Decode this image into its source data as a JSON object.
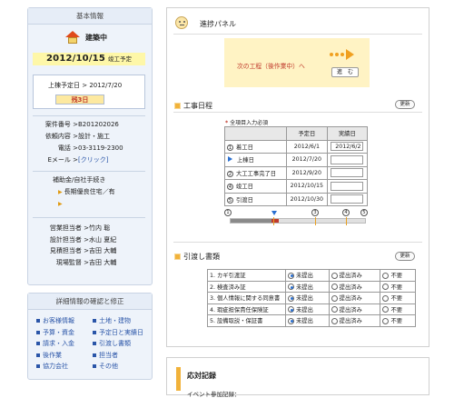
{
  "sidebar": {
    "basic_title": "基本情報",
    "status": "建築中",
    "date": "2012/10/15",
    "date_suffix": "竣工予定",
    "framing_label": "上棟予定日 > 2012/7/20",
    "remaining": "残3日",
    "case_no_label": "案件番号 > ",
    "case_no": "B201202026",
    "request_label": "依頼内容 > ",
    "request": "設計・施工",
    "phone_label": "電話 > ",
    "phone": "03-3119-2300",
    "email_label": "Eメール > ",
    "email": "[クリック]",
    "subsidy_label": "補助金/自社手続き",
    "subsidy_item": "長期優良住宅／有",
    "staff": [
      {
        "role": "営業担当者 > ",
        "name": "竹内 聡"
      },
      {
        "role": "設計担当者 > ",
        "name": "水山 夏紀"
      },
      {
        "role": "見積担当者 > ",
        "name": "吉田 大輔"
      },
      {
        "role": "現場監督 > ",
        "name": "吉田 大輔"
      }
    ],
    "detail_title": "詳細情報の確認と修正",
    "links": [
      "お客様情報",
      "土地・建物",
      "予算・資金",
      "予定日と実績日",
      "請求・入金",
      "引渡し書類",
      "後作業",
      "担当者",
      "協力会社",
      "その他"
    ]
  },
  "progress": {
    "title": "進捗パネル",
    "next_label": "次の工程（後作業中）へ",
    "next_button": "進　む"
  },
  "schedule": {
    "title": "工事日程",
    "update": "更新",
    "required_note": "全項目入力必須",
    "headers": [
      "",
      "予定日",
      "実績日"
    ],
    "rows": [
      {
        "no": "1",
        "name": "着工日",
        "plan": "2012/6/1",
        "actual": "2012/6/2"
      },
      {
        "no": "▶",
        "name": "上棟日",
        "plan": "2012/7/20",
        "actual": ""
      },
      {
        "no": "2",
        "name": "大工工事完了日",
        "plan": "2012/9/20",
        "actual": ""
      },
      {
        "no": "4",
        "name": "竣工日",
        "plan": "2012/10/15",
        "actual": ""
      },
      {
        "no": "5",
        "name": "引渡日",
        "plan": "2012/10/30",
        "actual": ""
      }
    ],
    "progress_fraction": 0.36
  },
  "handover": {
    "title": "引渡し書類",
    "update": "更新",
    "options": [
      "未提出",
      "提出済み",
      "不要"
    ],
    "rows": [
      {
        "name": "1. カギ引渡証",
        "selected": 0
      },
      {
        "name": "2. 検査済み証",
        "selected": 0
      },
      {
        "name": "3. 個人情報に関する同意書",
        "selected": 0
      },
      {
        "name": "4. 瑕疵担保責任保険証",
        "selected": 0
      },
      {
        "name": "5. 設備取説・保証書",
        "selected": 0
      }
    ]
  },
  "response": {
    "title": "応対記録",
    "sub": "イベント参加記録："
  }
}
